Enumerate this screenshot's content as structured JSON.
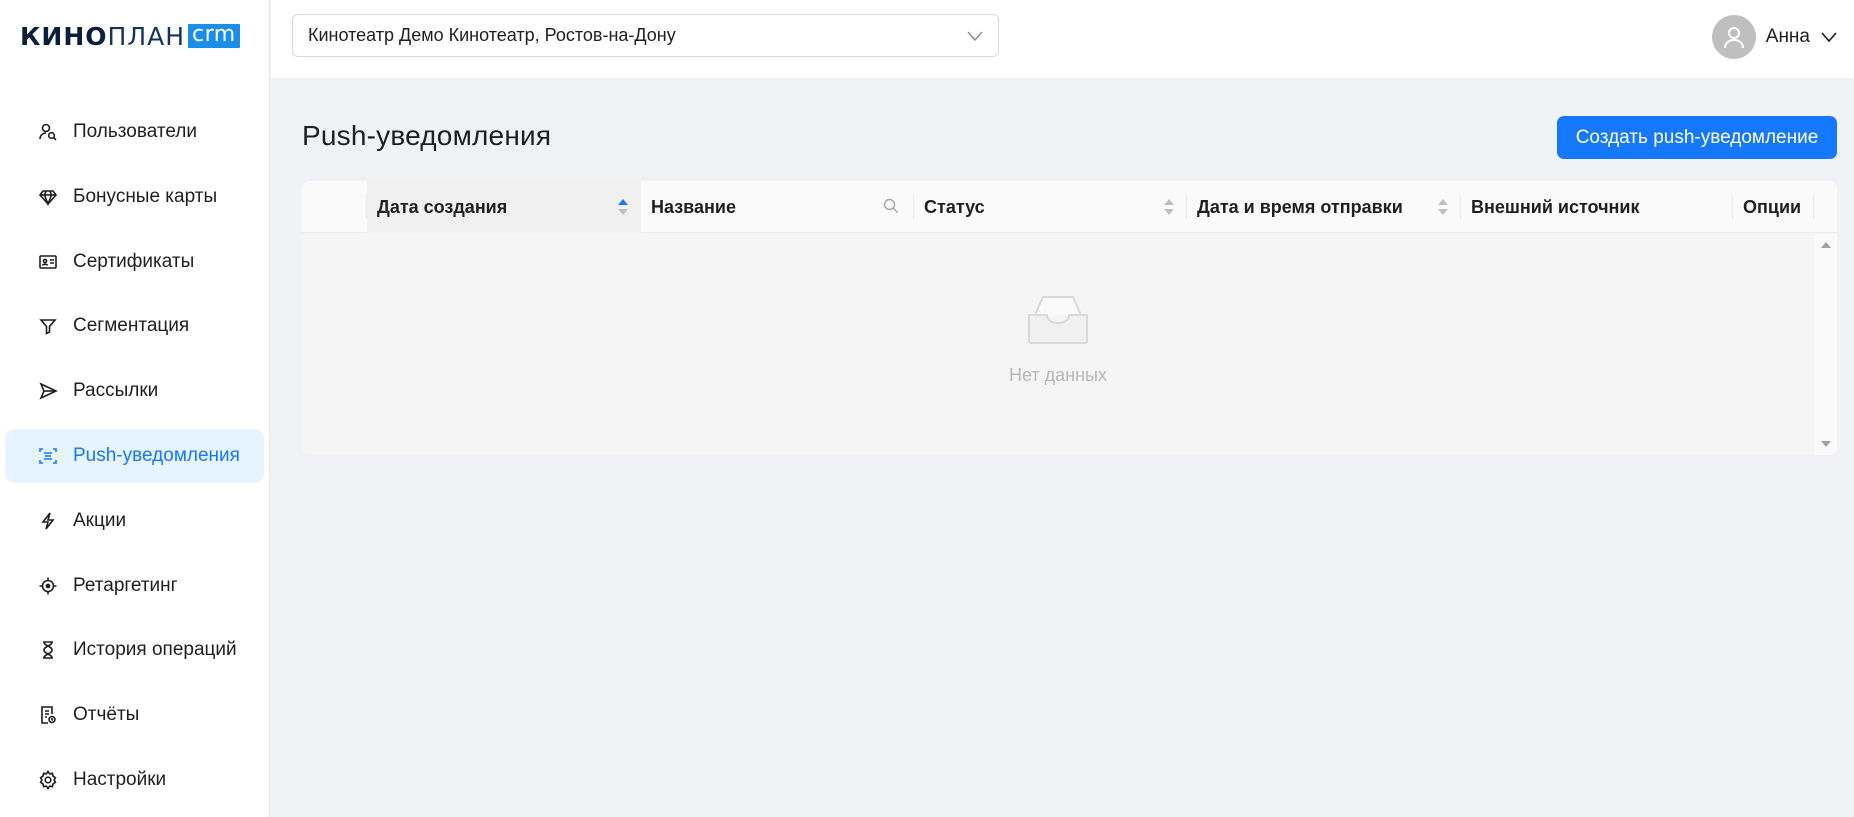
{
  "brand": {
    "part1": "КИНО",
    "part2": "ПЛАН",
    "badge": "crm",
    "accent": "#1a8ee8"
  },
  "sidebar": {
    "items": [
      {
        "label": "Пользователи",
        "icon": "user-search-icon",
        "active": false
      },
      {
        "label": "Бонусные карты",
        "icon": "diamond-icon",
        "active": false
      },
      {
        "label": "Сертификаты",
        "icon": "id-card-icon",
        "active": false
      },
      {
        "label": "Сегментация",
        "icon": "filter-icon",
        "active": false
      },
      {
        "label": "Рассылки",
        "icon": "send-icon",
        "active": false
      },
      {
        "label": "Push-уведомления",
        "icon": "push-scan-icon",
        "active": true
      },
      {
        "label": "Акции",
        "icon": "lightning-icon",
        "active": false
      },
      {
        "label": "Ретаргетинг",
        "icon": "target-icon",
        "active": false
      },
      {
        "label": "История операций",
        "icon": "hourglass-icon",
        "active": false
      },
      {
        "label": "Отчёты",
        "icon": "report-icon",
        "active": false
      },
      {
        "label": "Настройки",
        "icon": "gear-icon",
        "active": false
      }
    ]
  },
  "header": {
    "cinema_select_value": "Кинотеатр Демо Кинотеатр, Ростов-на-Дону",
    "user_name": "Анна"
  },
  "main": {
    "title": "Push-уведомления",
    "create_button": "Создать push-уведомление",
    "table": {
      "columns": [
        {
          "label": "Дата создания",
          "sortable": true,
          "sorted": "asc"
        },
        {
          "label": "Название",
          "searchable": true
        },
        {
          "label": "Статус",
          "sortable": true
        },
        {
          "label": "Дата и время отправки",
          "sortable": true
        },
        {
          "label": "Внешний источник"
        },
        {
          "label": "Опции"
        }
      ],
      "empty_text": "Нет данных"
    }
  },
  "colors": {
    "primary": "#1677ff",
    "active_bg": "#e6f4ff"
  }
}
